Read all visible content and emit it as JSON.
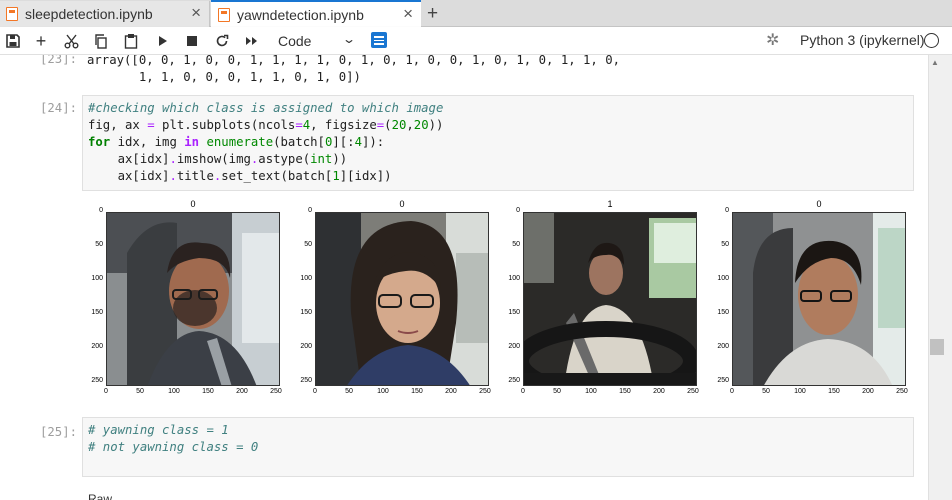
{
  "tabs": [
    {
      "label": "sleepdetection.ipynb"
    },
    {
      "label": "yawndetection.ipynb"
    }
  ],
  "toolbar": {
    "cell_type": "Code",
    "kernel_name": "Python 3 (ipykernel)"
  },
  "cells": {
    "out23": {
      "prompt": "[23]:",
      "line1": "array([0, 0, 1, 0, 0, 1, 1, 1, 1, 0, 1, 0, 1, 0, 0, 1, 0, 1, 0, 1, 1, 0,",
      "line2": "       1, 1, 0, 0, 0, 1, 1, 0, 1, 0])"
    },
    "in24": {
      "prompt": "[24]:",
      "comment": "#checking which class is assigned to which image",
      "l2a": "fig, ax ",
      "l2b": "=",
      "l2c": " plt.subplots(ncols",
      "l2d": "=",
      "l2e": "4",
      "l2f": ", figsize",
      "l2g": "=",
      "l2h": "(",
      "l2i": "20",
      "l2j": ",",
      "l2k": "20",
      "l2l": "))",
      "l3a": "for",
      "l3b": " idx, img ",
      "l3c": "in",
      "l3d": " ",
      "l3e": "enumerate",
      "l3f": "(batch[",
      "l3g": "0",
      "l3h": "][:",
      "l3i": "4",
      "l3j": "]):",
      "l4a": "    ax[idx]",
      "l4b": ".",
      "l4c": "imshow(img",
      "l4d": ".",
      "l4e": "astype(",
      "l4f": "int",
      "l4g": "))",
      "l5a": "    ax[idx]",
      "l5b": ".",
      "l5c": "title",
      "l5d": ".",
      "l5e": "set_text(batch[",
      "l5f": "1",
      "l5g": "][idx])"
    },
    "figure": {
      "titles": [
        "0",
        "0",
        "1",
        "0"
      ],
      "yticks": [
        "0",
        "50",
        "100",
        "150",
        "200",
        "250"
      ],
      "xticks": [
        "0",
        "50",
        "100",
        "150",
        "200",
        "250"
      ]
    },
    "in25": {
      "prompt": "[25]:",
      "line1": "# yawning class = 1",
      "line2": "# not yawning class = 0"
    },
    "raw_label": "Raw"
  }
}
